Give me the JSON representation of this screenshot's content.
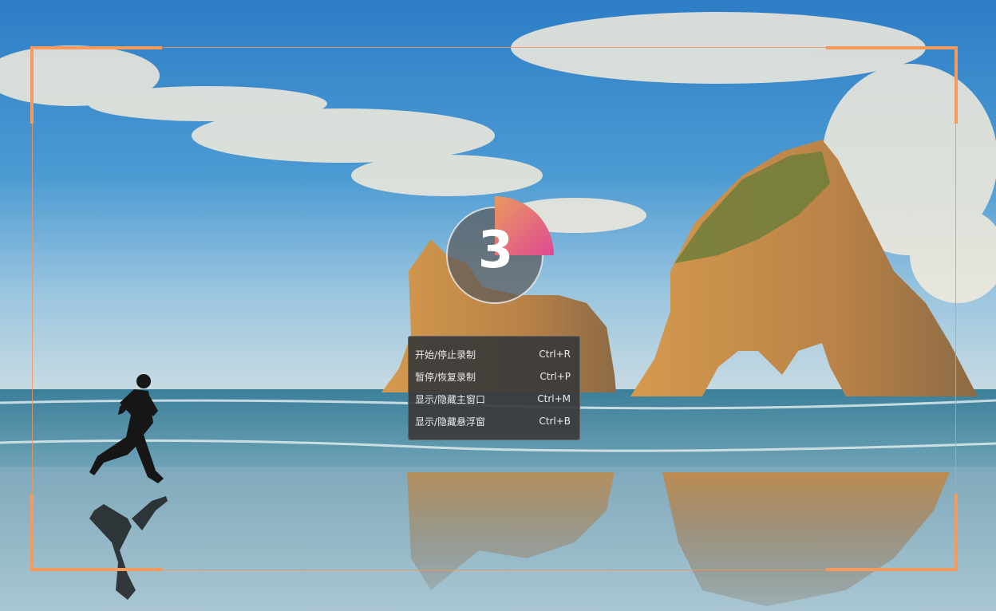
{
  "wallpaper": {
    "description_icon": "beach-landscape-wallpaper",
    "colors": {
      "sky_top": "#2f7fc4",
      "sky_bottom": "#9ec7df",
      "sea": "#4f89a3",
      "sand": "#8fb4c4",
      "rock": "#b98a52",
      "accent": "#f39a5c"
    }
  },
  "countdown": {
    "value": "3",
    "progress_fraction": 0.25,
    "ring_colors": [
      "#e8985f",
      "#e04a92"
    ]
  },
  "shortcut_menu": {
    "items": [
      {
        "label": "开始/停止录制",
        "shortcut": "Ctrl+R"
      },
      {
        "label": "暂停/恢复录制",
        "shortcut": "Ctrl+P"
      },
      {
        "label": "显示/隐藏主窗口",
        "shortcut": "Ctrl+M"
      },
      {
        "label": "显示/隐藏悬浮窗",
        "shortcut": "Ctrl+B"
      }
    ]
  }
}
